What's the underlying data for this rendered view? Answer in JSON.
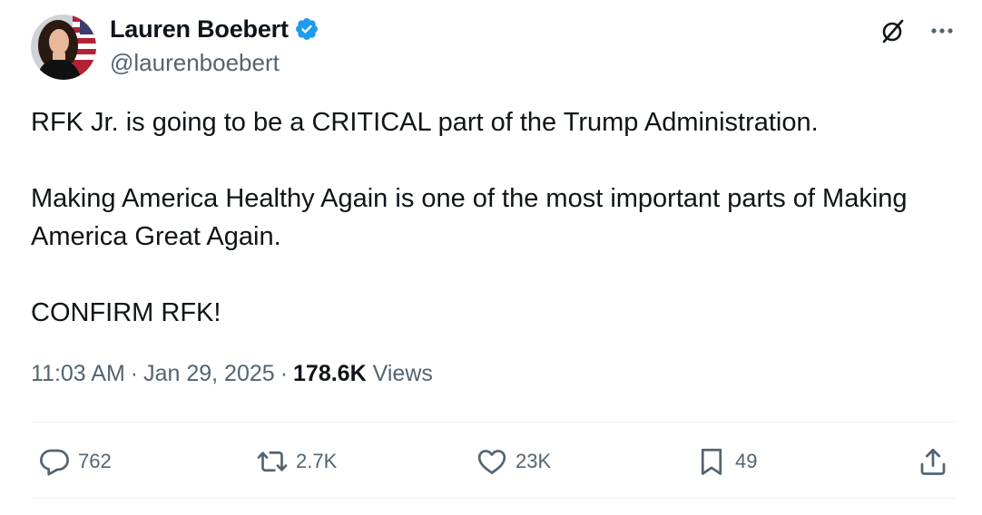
{
  "author": {
    "display_name": "Lauren Boebert",
    "handle": "@laurenboebert",
    "verified": true,
    "verified_color": "#1d9bf0",
    "avatar_icon": "profile-photo"
  },
  "header_icons": {
    "grok": "grok-icon",
    "more": "more-icon"
  },
  "tweet": {
    "paragraphs": [
      "RFK Jr. is going to be a CRITICAL part of the Trump Administration.",
      "Making America Healthy Again is one of the most important parts of Making America Great Again.",
      "CONFIRM RFK!"
    ]
  },
  "meta": {
    "time": "11:03 AM",
    "separator": "·",
    "date": "Jan 29, 2025",
    "views_count": "178.6K",
    "views_label": "Views"
  },
  "actions": {
    "reply": {
      "count": "762",
      "icon": "reply-icon"
    },
    "repost": {
      "count": "2.7K",
      "icon": "repost-icon"
    },
    "like": {
      "count": "23K",
      "icon": "heart-icon"
    },
    "bookmark": {
      "count": "49",
      "icon": "bookmark-icon"
    },
    "share": {
      "icon": "share-icon"
    }
  },
  "colors": {
    "text_primary": "#0f1419",
    "text_secondary": "#536471",
    "divider": "#eff3f4",
    "verified": "#1d9bf0"
  }
}
